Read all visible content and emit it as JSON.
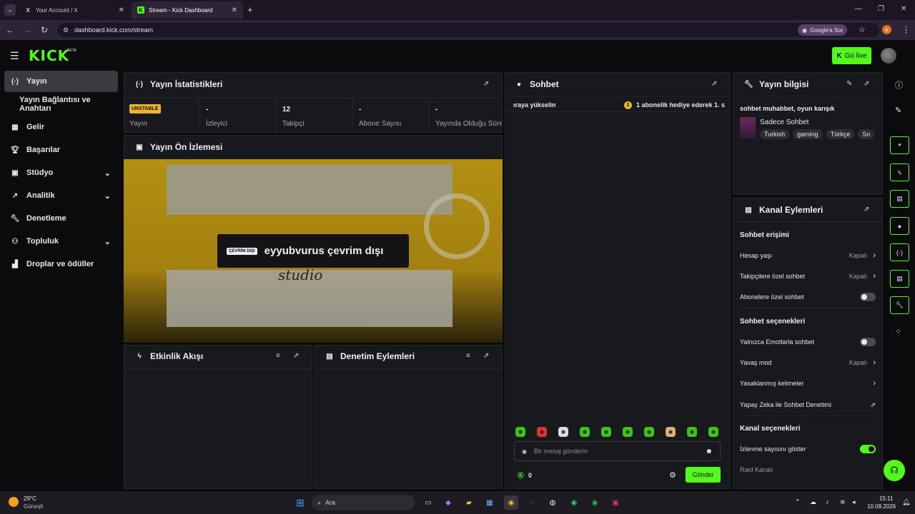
{
  "browser": {
    "tabs": [
      {
        "label": "Your Account / X",
        "icon": "x-logo-icon"
      },
      {
        "label": "Stream - Kick Dashboard",
        "icon": "kick-logo-icon"
      }
    ],
    "new_tab": "+",
    "url": "dashboard.kick.com/stream",
    "google_sor": "Google'a Sor",
    "profile_initial": "e"
  },
  "header": {
    "logo": "KICK",
    "beta": "BETA",
    "go_live": "Go live"
  },
  "sidebar": {
    "items": [
      {
        "label": "Yayın",
        "icon": "broadcast-icon"
      },
      {
        "label": "Yayın Bağlantısı ve Anahtarı"
      },
      {
        "label": "Gelir",
        "icon": "revenue-icon"
      },
      {
        "label": "Başarılar",
        "icon": "trophy-icon"
      },
      {
        "label": "Stüdyo",
        "icon": "studio-icon"
      },
      {
        "label": "Analitik",
        "icon": "analytics-icon"
      },
      {
        "label": "Denetleme",
        "icon": "wrench-icon"
      },
      {
        "label": "Topluluk",
        "icon": "community-icon"
      },
      {
        "label": "Droplar ve ödüller",
        "icon": "drops-icon"
      }
    ]
  },
  "stats": {
    "title": "Yayın İstatistikleri",
    "badge": "UNSTABLE",
    "items": [
      {
        "value": "",
        "label": "Yayın"
      },
      {
        "value": "-",
        "label": "İzleyici"
      },
      {
        "value": "12",
        "label": "Takipçi"
      },
      {
        "value": "-",
        "label": "Abone Sayısı"
      },
      {
        "value": "-",
        "label": "Yayında Olduğu Süre"
      }
    ]
  },
  "preview": {
    "title": "Yayın Ön İzlemesi",
    "offline_badge": "ÇEVRİM DIŞI",
    "offline_text": "eyyubvurus çevrim dışı",
    "script_text": "studio"
  },
  "activity": {
    "title": "Etkinlik Akışı"
  },
  "mod_actions": {
    "title": "Denetim Eylemleri"
  },
  "chat": {
    "title": "Sohbet",
    "ticker_left": "ıraya yükselin",
    "ticker_badge": "1",
    "ticker_right": "1 abonelik hediye ederek 1. s",
    "placeholder": "Bir mesaj gönderin",
    "points": "0",
    "send": "Gönder"
  },
  "stream_info": {
    "title": "Yayın bilgisi",
    "stream_title": "sohbet muhabbet, oyun karışık",
    "category": "Sadece Sohbet",
    "tags": [
      "Turkish",
      "gaming",
      "Türkçe",
      "So"
    ]
  },
  "channel_actions": {
    "title": "Kanal Eylemleri",
    "chat_access": {
      "heading": "Sohbet erişimi",
      "rows": [
        {
          "label": "Hesap yaşı",
          "value": "Kapalı"
        },
        {
          "label": "Takipçilere özel sohbet",
          "value": "Kapalı"
        },
        {
          "label": "Abonelere özel sohbet",
          "toggle": false
        }
      ]
    },
    "chat_options": {
      "heading": "Sohbet seçenekleri",
      "rows": [
        {
          "label": "Yalnızca Emotlarla sohbet",
          "toggle": false
        },
        {
          "label": "Yavaş mod",
          "value": "Kapalı"
        },
        {
          "label": "Yasaklanmış kelimeler"
        },
        {
          "label": "Yapay Zeka ile Sohbet Denetimi"
        }
      ]
    },
    "channel_options": {
      "heading": "Kanal seçenekleri",
      "rows": [
        {
          "label": "İzlenme sayısını göster",
          "toggle": true
        },
        {
          "label": "Raid Kanalı"
        }
      ]
    }
  },
  "taskbar": {
    "weather_temp": "29°C",
    "weather_desc": "Güneşli",
    "search": "Ara",
    "time": "15:11",
    "date": "10.08.2026"
  },
  "colors": {
    "accent": "#53fc18",
    "unstable": "#f0b429",
    "panel": "#18191c"
  }
}
